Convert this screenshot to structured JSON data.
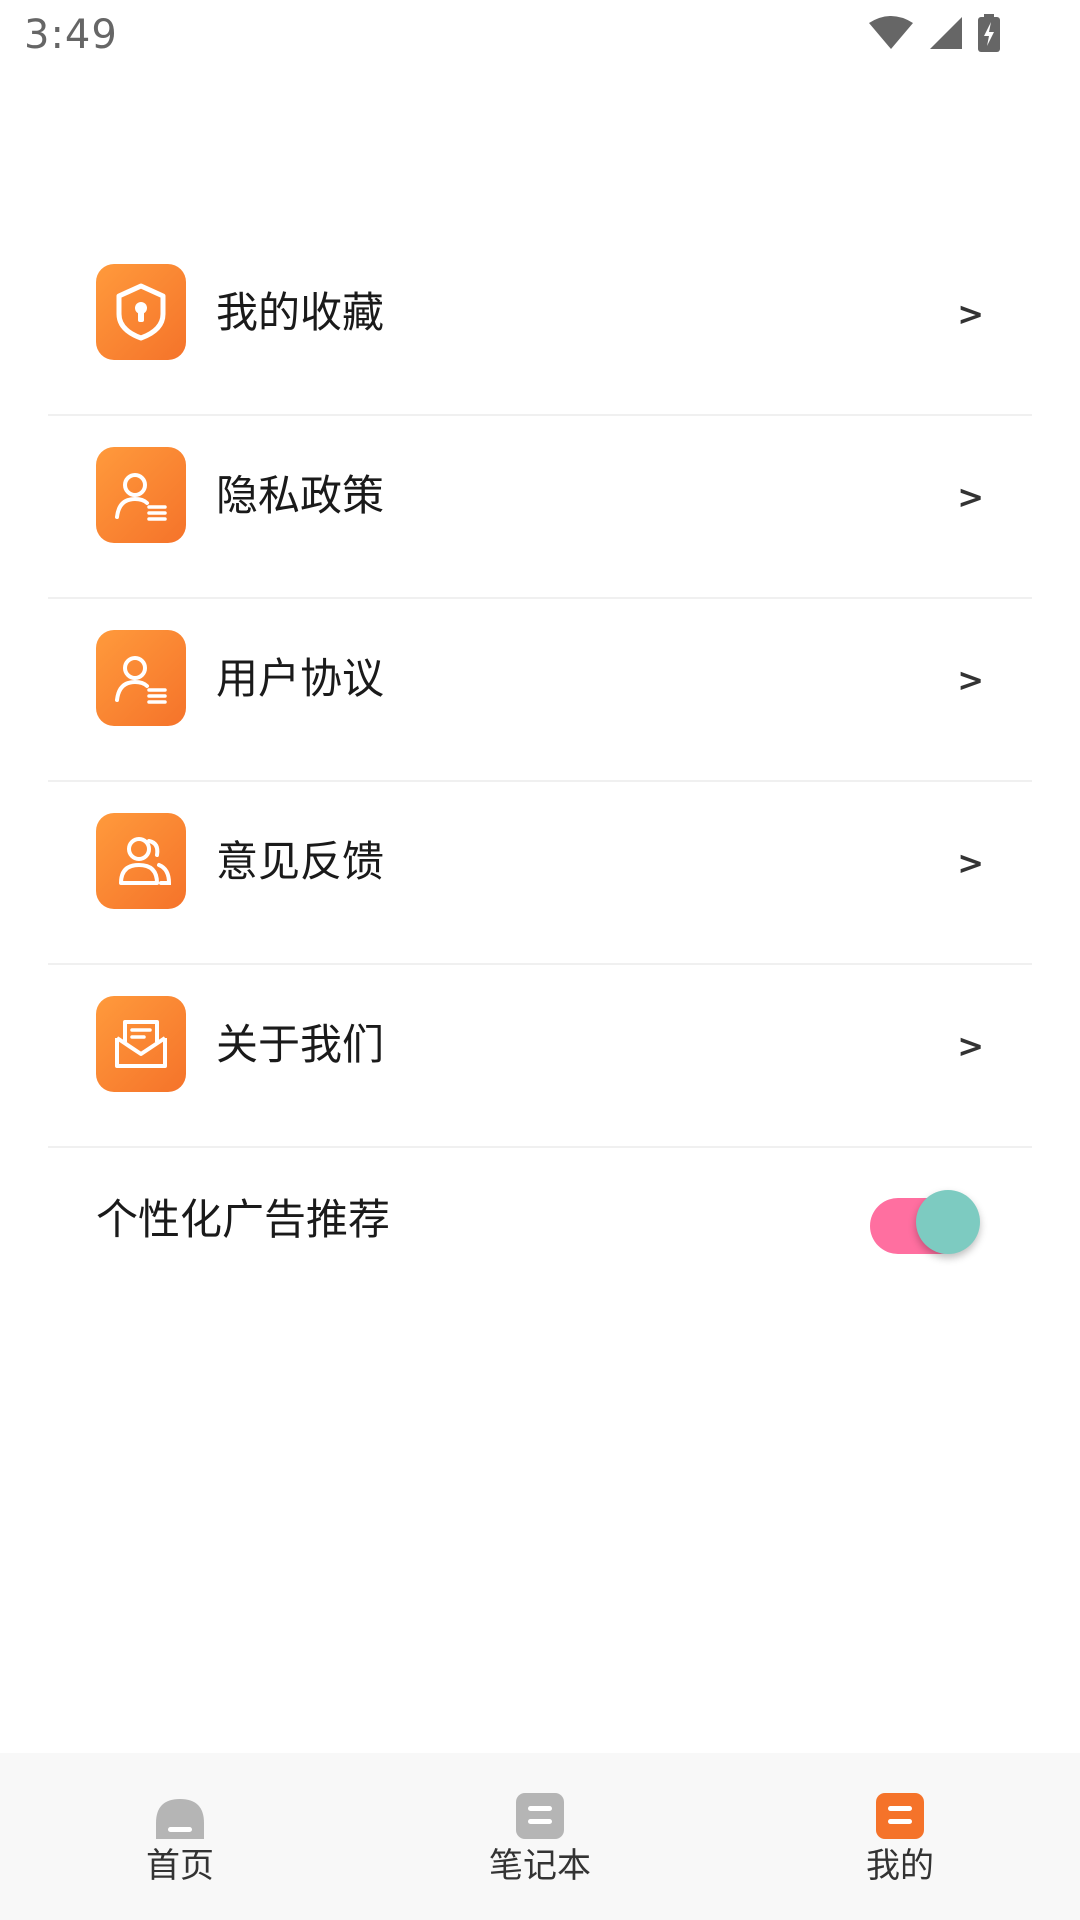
{
  "status_bar": {
    "time": "3:49"
  },
  "menu": {
    "items": [
      {
        "label": "我的收藏",
        "icon": "shield-lock-icon",
        "chevron": ">"
      },
      {
        "label": "隐私政策",
        "icon": "user-list-icon",
        "chevron": ">"
      },
      {
        "label": "用户协议",
        "icon": "user-list-icon",
        "chevron": ">"
      },
      {
        "label": "意见反馈",
        "icon": "users-group-icon",
        "chevron": ">"
      },
      {
        "label": "关于我们",
        "icon": "mail-open-icon",
        "chevron": ">"
      }
    ]
  },
  "ad_setting": {
    "label": "个性化广告推荐",
    "enabled": true
  },
  "bottom_nav": {
    "items": [
      {
        "label": "首页",
        "icon": "home-icon",
        "active": false
      },
      {
        "label": "笔记本",
        "icon": "notebook-icon",
        "active": false
      },
      {
        "label": "我的",
        "icon": "profile-icon",
        "active": true
      }
    ]
  },
  "colors": {
    "accent": "#f5732a",
    "accent_light": "#ff9a3c",
    "toggle_track": "#ff6fa0",
    "toggle_thumb": "#7dcbc1",
    "inactive_icon": "#b5b5b5"
  }
}
